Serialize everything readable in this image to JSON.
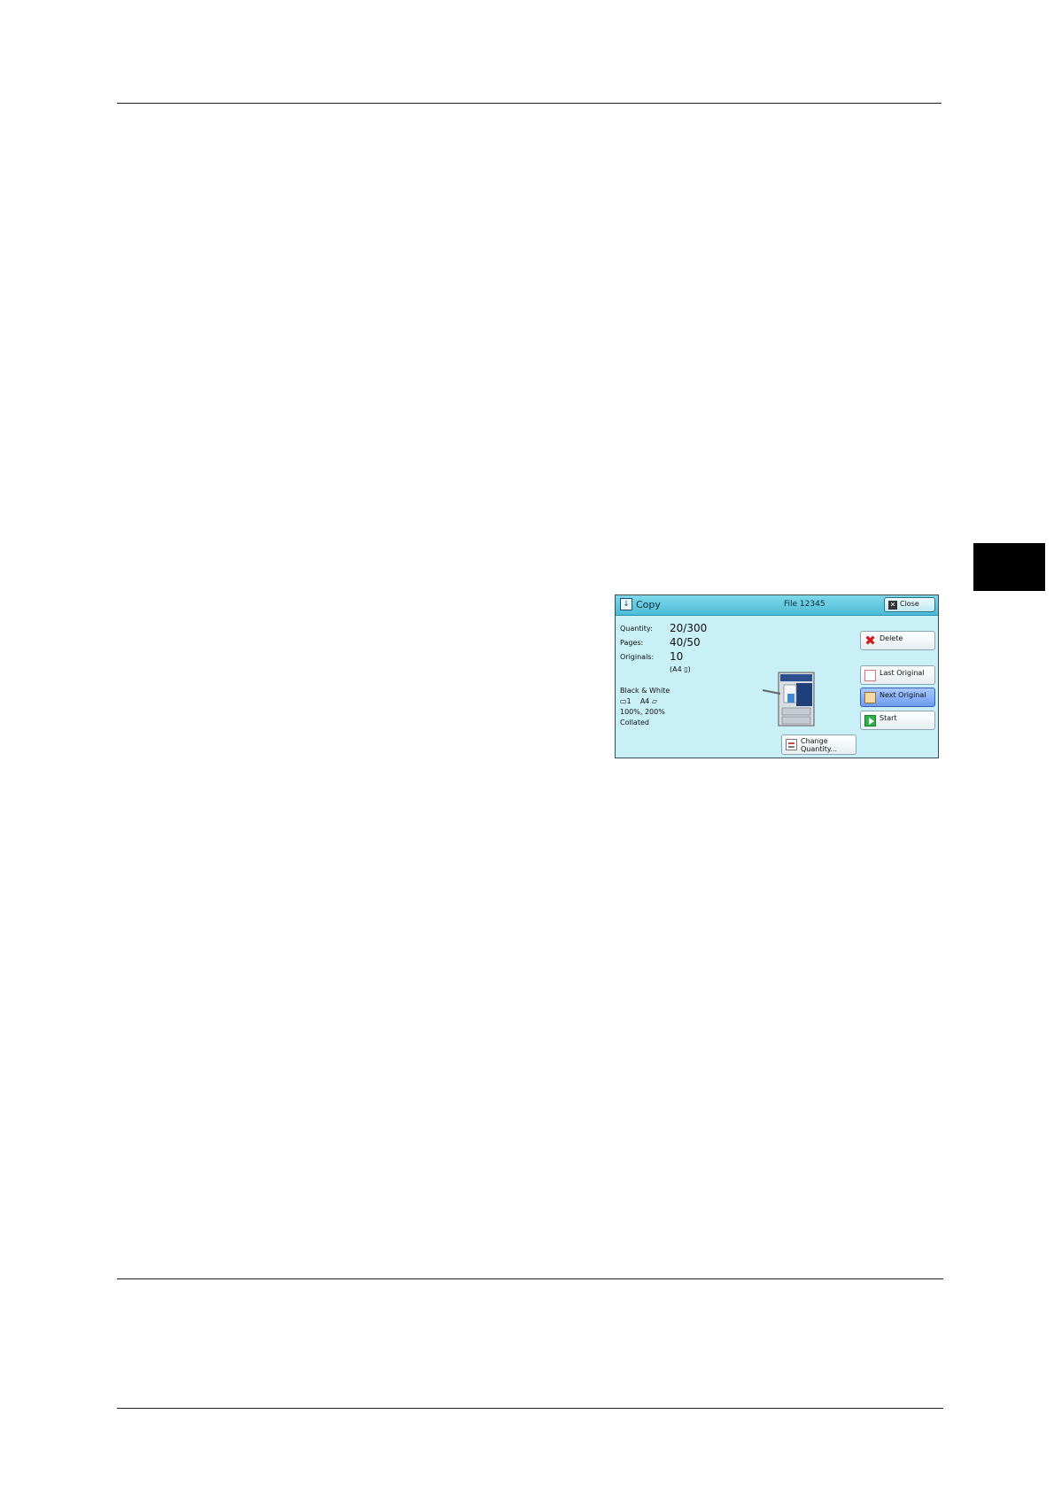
{
  "panel": {
    "title": "Copy",
    "title_icon": "download-icon",
    "file": "File 12345",
    "close_label": "Close",
    "quantity_label": "Quantity:",
    "quantity_value": "20/300",
    "pages_label": "Pages:",
    "pages_value": "40/50",
    "originals_label": "Originals:",
    "originals_value": "10",
    "originals_size": "(A4 ▯)",
    "settings": [
      "Black & White",
      "▭1    A4 ▱",
      "100%, 200%",
      "Collated"
    ],
    "buttons": {
      "delete": "Delete",
      "last_original": "Last Original",
      "next_original": "Next Original",
      "start": "Start",
      "change_quantity_1": "Change",
      "change_quantity_2": "Quantity..."
    },
    "colors": {
      "panel_bg": "#c9f0f6",
      "titlebar": "#4cbcd8",
      "active_button": "#6c9cf0"
    }
  }
}
